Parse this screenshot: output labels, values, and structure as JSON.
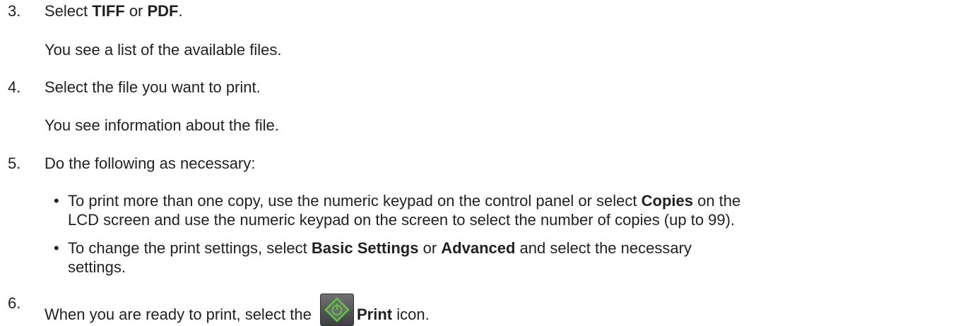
{
  "steps": [
    {
      "number": "3.",
      "parts": [
        "Select ",
        "TIFF",
        " or ",
        "PDF",
        "."
      ],
      "followup": "You see a list of the available files."
    },
    {
      "number": "4.",
      "text": "Select the file you want to print.",
      "followup": "You see information about the file."
    },
    {
      "number": "5.",
      "text": "Do the following as necessary:",
      "bullets": [
        {
          "line1": [
            "To print more than one copy, use the numeric keypad on the control panel or select ",
            "Copies",
            " on the"
          ],
          "line2": "LCD screen and use the numeric keypad on the screen to select the number of copies (up to 99)."
        },
        {
          "line1": [
            "To change the print settings, select ",
            "Basic Settings",
            " or ",
            "Advanced",
            " and select the necessary"
          ],
          "line2": "settings."
        }
      ]
    },
    {
      "number": "6.",
      "parts": [
        "When you are ready to print, select the ",
        "Print",
        " icon."
      ],
      "icon": "print-start-icon"
    }
  ],
  "bullet_char": "•",
  "colors": {
    "text": "#231f20",
    "icon_bg": "#555759",
    "icon_symbol": "#5fc63b"
  }
}
